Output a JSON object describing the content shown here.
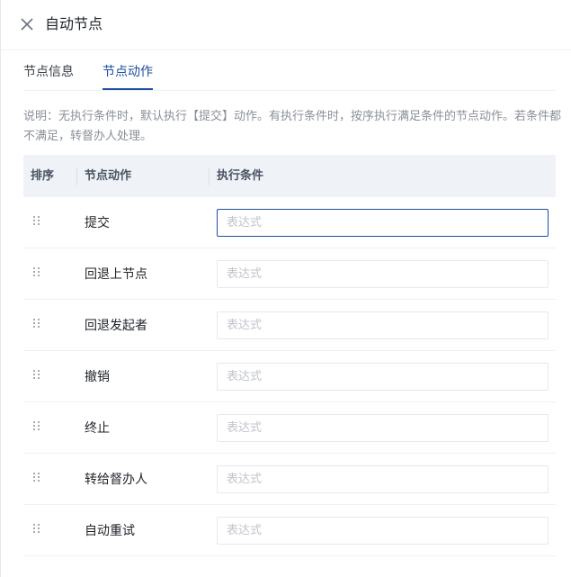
{
  "header": {
    "title": "自动节点"
  },
  "tabs": [
    {
      "label": "节点信息",
      "active": false
    },
    {
      "label": "节点动作",
      "active": true
    }
  ],
  "note": "说明：无执行条件时，默认执行【提交】动作。有执行条件时，按序执行满足条件的节点动作。若条件都不满足，转督办人处理。",
  "table": {
    "headers": {
      "order": "排序",
      "action": "节点动作",
      "condition": "执行条件"
    },
    "rows": [
      {
        "action": "提交",
        "placeholder": "表达式",
        "focused": true
      },
      {
        "action": "回退上节点",
        "placeholder": "表达式",
        "focused": false
      },
      {
        "action": "回退发起者",
        "placeholder": "表达式",
        "focused": false
      },
      {
        "action": "撤销",
        "placeholder": "表达式",
        "focused": false
      },
      {
        "action": "终止",
        "placeholder": "表达式",
        "focused": false
      },
      {
        "action": "转给督办人",
        "placeholder": "表达式",
        "focused": false
      },
      {
        "action": "自动重试",
        "placeholder": "表达式",
        "focused": false
      }
    ]
  },
  "colors": {
    "accent": "#1d4ea2",
    "header_bg": "#eff2f7",
    "muted_text": "#8a8f99"
  }
}
